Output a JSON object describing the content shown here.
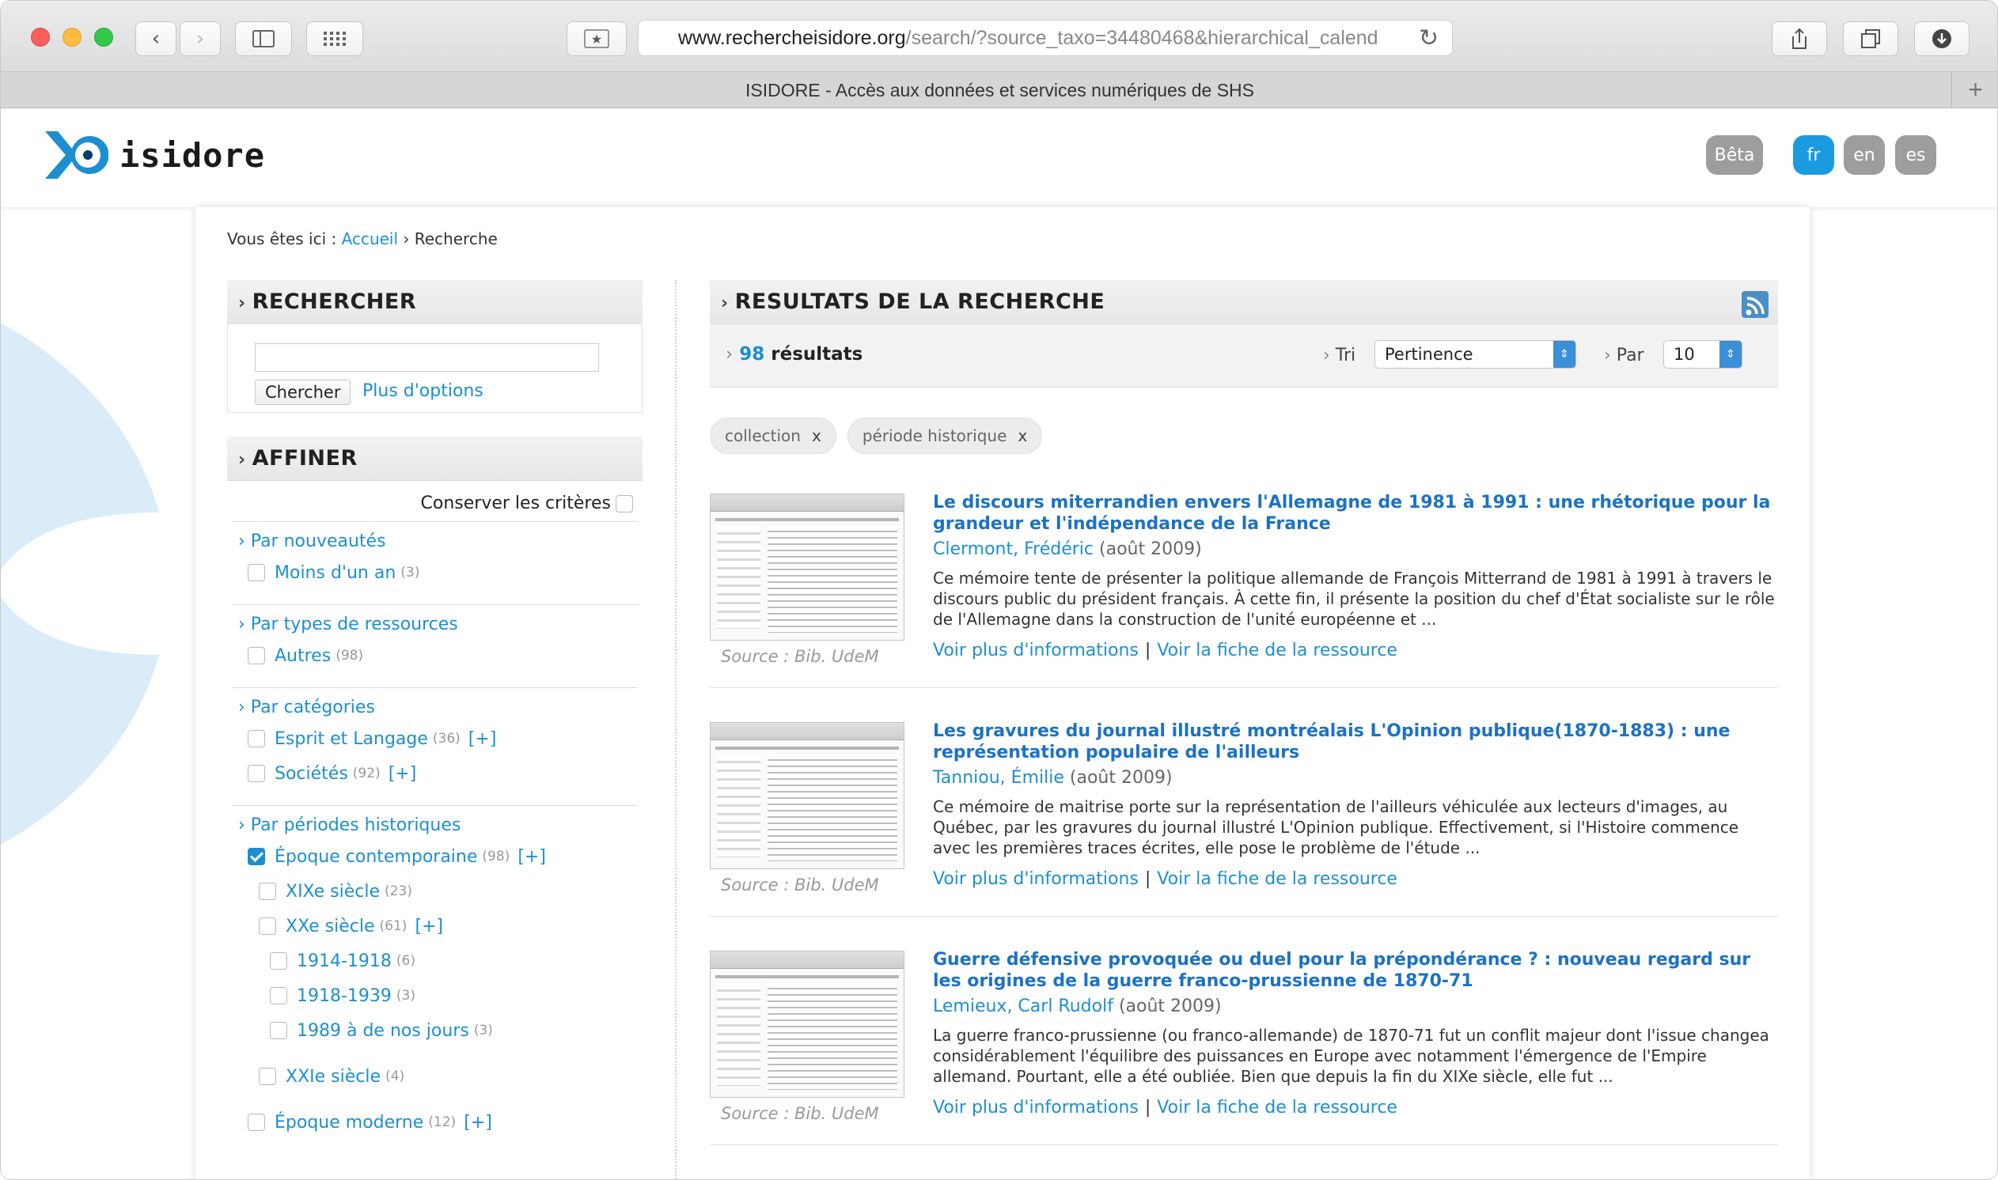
{
  "browser": {
    "url_host": "www.rechercheisidore.org",
    "url_rest": "/search/?source_taxo=34480468&hierarchical_calend",
    "tab_title": "ISIDORE - Accès aux données et services numériques de SHS"
  },
  "header": {
    "logo_text": "isidore",
    "beta": "Bêta",
    "lang_fr": "fr",
    "lang_en": "en",
    "lang_es": "es"
  },
  "breadcrumb": {
    "prefix": "Vous êtes ici :",
    "home": "Accueil",
    "sep": "›",
    "current": "Recherche"
  },
  "search": {
    "title": "RECHERCHER",
    "button": "Chercher",
    "more_options": "Plus d'options"
  },
  "refine": {
    "title": "AFFINER",
    "keep_criteria": "Conserver les critères",
    "groups": [
      {
        "title": "Par nouveautés",
        "items": [
          {
            "label": "Moins d'un an",
            "count": "(3)"
          }
        ]
      },
      {
        "title": "Par types de ressources",
        "items": [
          {
            "label": "Autres",
            "count": "(98)"
          }
        ]
      },
      {
        "title": "Par catégories",
        "items": [
          {
            "label": "Esprit et Langage",
            "count": "(36)",
            "plus": "[+]"
          },
          {
            "label": "Sociétés",
            "count": "(92)",
            "plus": "[+]"
          }
        ]
      },
      {
        "title": "Par périodes historiques",
        "items": [
          {
            "label": "Époque contemporaine",
            "count": "(98)",
            "plus": "[+]",
            "checked": true
          },
          {
            "label": "XIXe siècle",
            "count": "(23)"
          },
          {
            "label": "XXe siècle",
            "count": "(61)",
            "plus": "[+]"
          },
          {
            "label": "1914-1918",
            "count": "(6)"
          },
          {
            "label": "1918-1939",
            "count": "(3)"
          },
          {
            "label": "1989 à de nos jours",
            "count": "(3)"
          },
          {
            "label": "XXIe siècle",
            "count": "(4)"
          },
          {
            "label": "Époque moderne",
            "count": "(12)",
            "plus": "[+]"
          }
        ]
      }
    ]
  },
  "results": {
    "title": "RESULTATS DE LA RECHERCHE",
    "count": "98",
    "count_label": "résultats",
    "sort_label": "Tri",
    "sort_value": "Pertinence",
    "per_label": "Par",
    "per_value": "10",
    "filters": [
      "collection",
      "période historique"
    ],
    "filter_remove": "x",
    "source_label": "Source : Bib. UdeM",
    "link_more": "Voir plus d'informations",
    "link_sep": "|",
    "link_sheet": "Voir la fiche de la ressource",
    "items": [
      {
        "title": "Le discours miterrandien envers l'Allemagne de 1981 à 1991 : une rhétorique pour la grandeur et l'indépendance de la France",
        "author": "Clermont, Frédéric",
        "date": "(août 2009)",
        "description": "Ce mémoire tente de présenter la politique allemande de François Mitterrand de 1981 à 1991 à travers le discours public du président français. À cette fin, il présente la position du chef d'État socialiste sur le rôle de l'Allemagne dans la construction de l'unité européenne et ..."
      },
      {
        "title": "Les gravures du journal illustré montréalais L'Opinion publique(1870-1883) : une représentation populaire de l'ailleurs",
        "author": "Tanniou, Émilie",
        "date": "(août 2009)",
        "description": "Ce mémoire de maitrise porte sur la représentation de l'ailleurs véhiculée aux lecteurs d'images, au Québec, par les gravures du journal illustré L'Opinion publique. Effectivement, si l'Histoire commence avec les premières traces écrites, elle pose le problème de l'étude ..."
      },
      {
        "title": "Guerre défensive provoquée ou duel pour la prépondérance ? : nouveau regard sur les origines de la guerre franco-prussienne de 1870-71",
        "author": "Lemieux, Carl Rudolf",
        "date": "(août 2009)",
        "description": "La guerre franco-prussienne (ou franco-allemande) de 1870-71 fut un conflit majeur dont l'issue changea considérablement l'équilibre des puissances en Europe avec notamment l'émergence de l'Empire allemand. Pourtant, elle a été oubliée. Bien que depuis la fin du XIXe siècle, elle fut ..."
      }
    ]
  }
}
